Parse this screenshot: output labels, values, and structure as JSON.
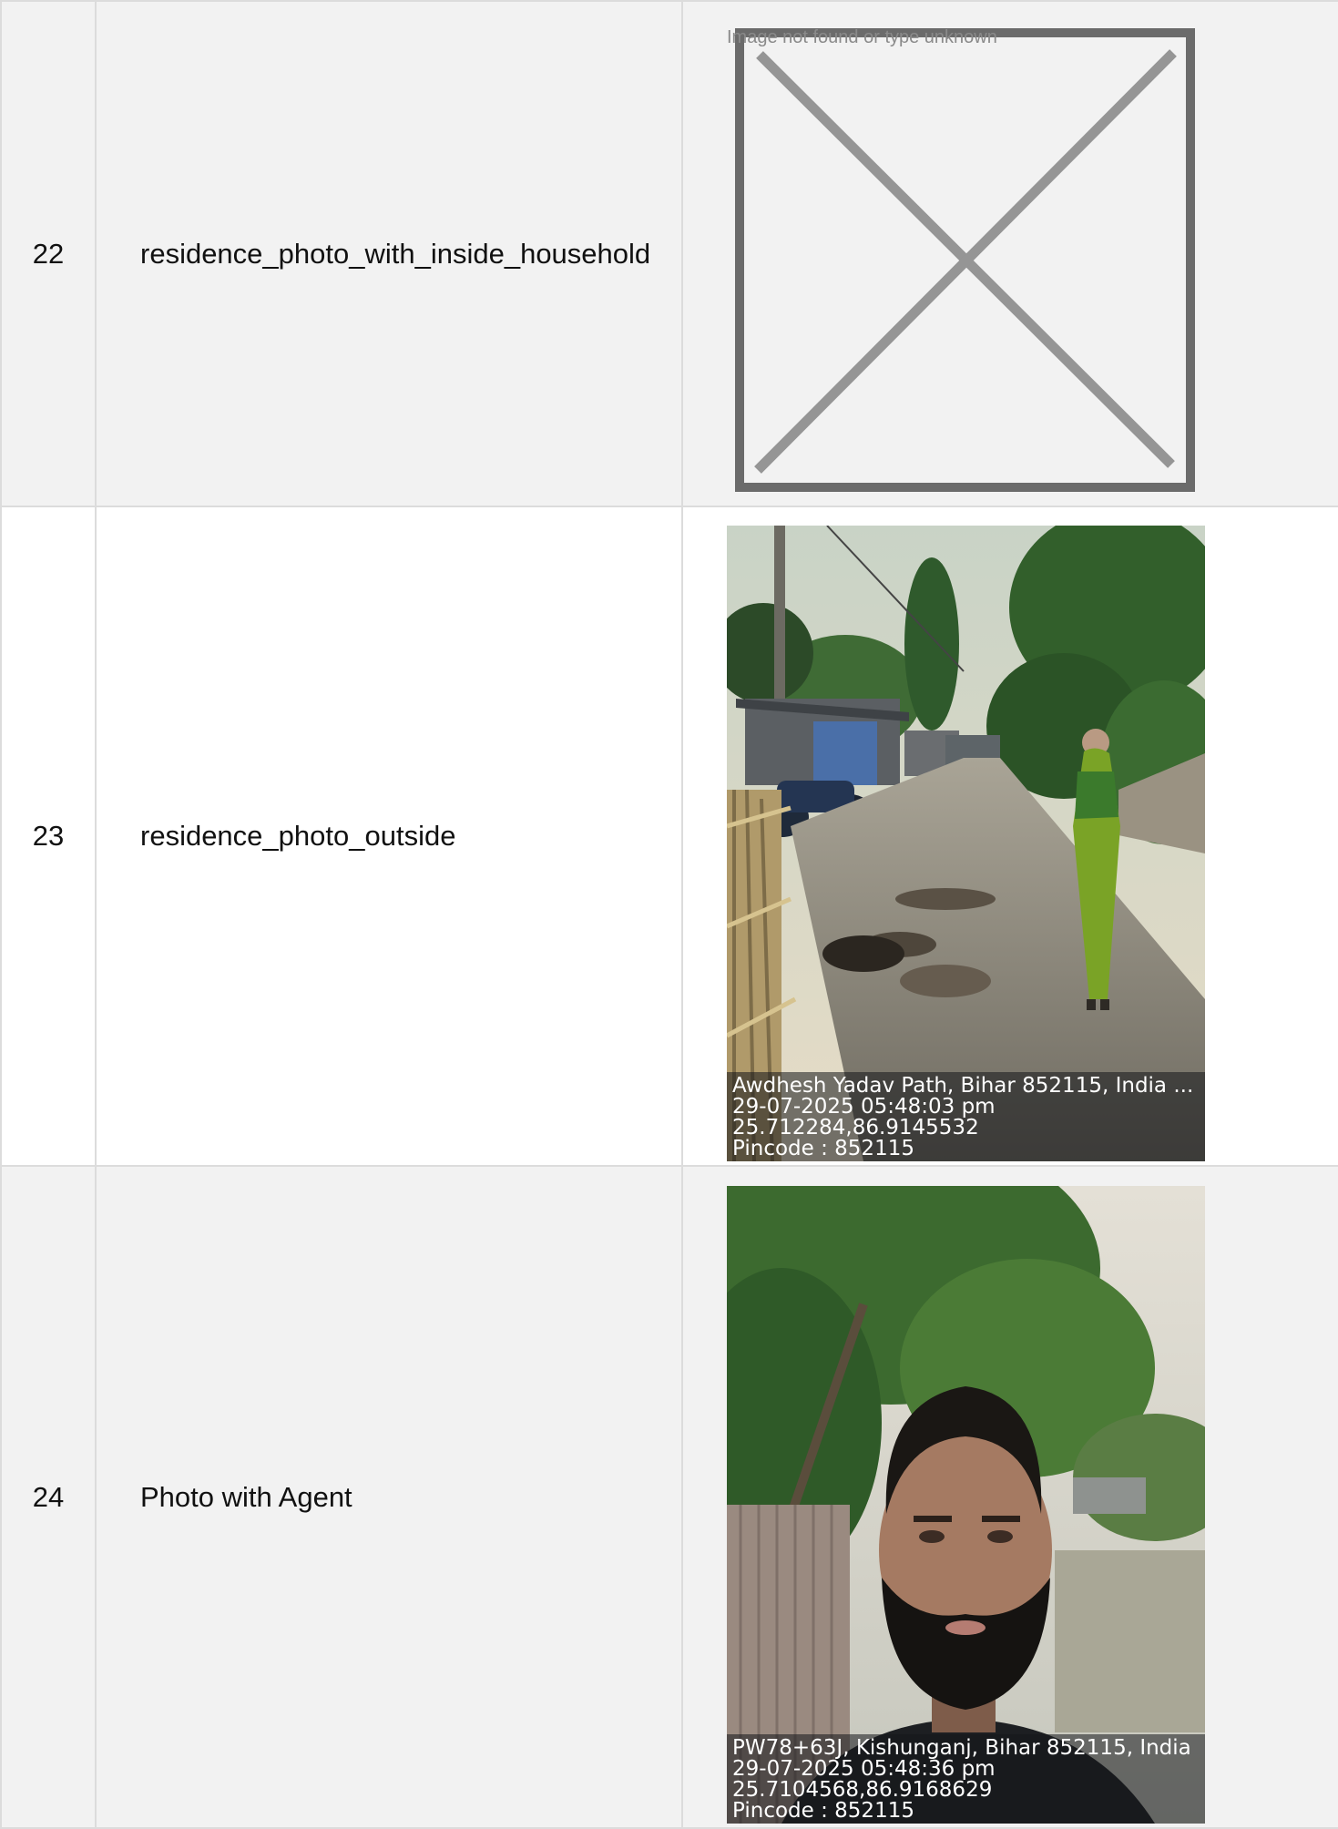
{
  "rows": [
    {
      "number": "22",
      "label": "residence_photo_with_inside_household",
      "image_alt": "Image not found or type unknown"
    },
    {
      "number": "23",
      "label": "residence_photo_outside",
      "stamp": {
        "address": "Awdhesh Yadav Path, Bihar 852115, India ...",
        "datetime": "29-07-2025 05:48:03 pm",
        "coords": "25.712284,86.9145532",
        "pincode": "Pincode : 852115"
      }
    },
    {
      "number": "24",
      "label": "Photo with Agent",
      "stamp": {
        "address": "PW78+63J, Kishunganj, Bihar 852115, India",
        "datetime": "29-07-2025 05:48:36 pm",
        "coords": "25.7104568,86.9168629",
        "pincode": "Pincode : 852115"
      }
    }
  ],
  "icons": {
    "broken_image": "broken-image-icon"
  }
}
